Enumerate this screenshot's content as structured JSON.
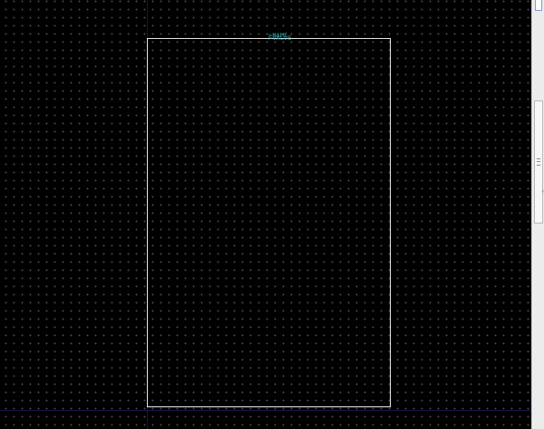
{
  "canvas": {
    "colors": {
      "background": "#000000",
      "grid_dot": "#4a4a4a",
      "outline": "#e8e8e8",
      "text": "#2fb5b5",
      "axis": "#15154a"
    },
    "name_placeholder": ">NAME",
    "value_placeholder": ">VALUE"
  },
  "scrollbar": {
    "up_arrow_icon": "arrow-up-icon",
    "grip_icon": "grip-lines-icon",
    "side_tick_glyph": "‹"
  }
}
